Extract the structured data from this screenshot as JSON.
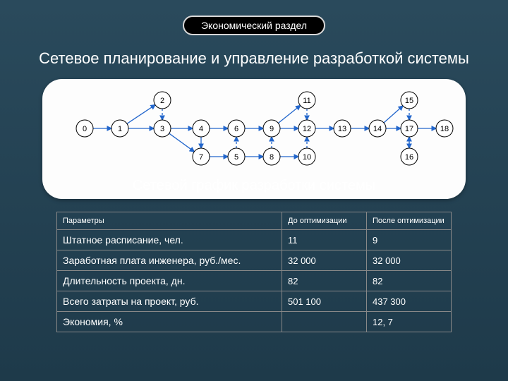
{
  "badge": "Экономический раздел",
  "title": "Сетевое планирование и управление разработкой системы",
  "caption": "Сетевой график разработки системы",
  "graph": {
    "rowTop": [
      2,
      11,
      15
    ],
    "rowMid": [
      0,
      1,
      3,
      4,
      6,
      9,
      12,
      13,
      14,
      17,
      18
    ],
    "rowBot": [
      7,
      5,
      8,
      10,
      16
    ]
  },
  "table": {
    "headers": [
      "Параметры",
      "До оптимизации",
      "После оптимизации"
    ],
    "rows": [
      [
        "Штатное расписание, чел.",
        "11",
        "9"
      ],
      [
        "Заработная плата инженера, руб./мес.",
        "32 000",
        "32 000"
      ],
      [
        "Длительность проекта, дн.",
        "82",
        "82"
      ],
      [
        "Всего затраты на проект, руб.",
        "501 100",
        "437 300"
      ],
      [
        "Экономия, %",
        "",
        "12, 7"
      ]
    ]
  },
  "chart_data": {
    "type": "table",
    "title": "Сетевой график разработки системы",
    "nodes": [
      0,
      1,
      2,
      3,
      4,
      5,
      6,
      7,
      8,
      9,
      10,
      11,
      12,
      13,
      14,
      15,
      16,
      17,
      18
    ],
    "layout": {
      "top": [
        2,
        11,
        15
      ],
      "middle": [
        0,
        1,
        3,
        4,
        6,
        9,
        12,
        13,
        14,
        17,
        18
      ],
      "bottom": [
        7,
        5,
        8,
        10,
        16
      ]
    },
    "edges_approx": [
      [
        0,
        1
      ],
      [
        1,
        2
      ],
      [
        1,
        3
      ],
      [
        2,
        3
      ],
      [
        3,
        4
      ],
      [
        3,
        7
      ],
      [
        4,
        6
      ],
      [
        4,
        7
      ],
      [
        7,
        5
      ],
      [
        5,
        6
      ],
      [
        6,
        9
      ],
      [
        5,
        8
      ],
      [
        8,
        9
      ],
      [
        8,
        10
      ],
      [
        9,
        11
      ],
      [
        9,
        12
      ],
      [
        10,
        12
      ],
      [
        11,
        12
      ],
      [
        12,
        13
      ],
      [
        13,
        14
      ],
      [
        14,
        15
      ],
      [
        14,
        17
      ],
      [
        15,
        17
      ],
      [
        17,
        16
      ],
      [
        16,
        17
      ],
      [
        17,
        18
      ]
    ]
  }
}
